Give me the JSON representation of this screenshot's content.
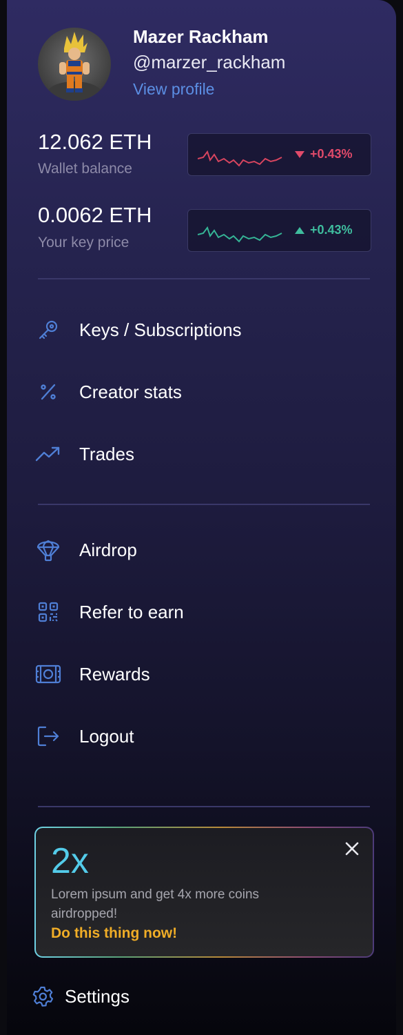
{
  "profile": {
    "name": "Mazer Rackham",
    "handle": "@marzer_rackham",
    "view_profile": "View profile"
  },
  "stats": [
    {
      "value": "12.062 ETH",
      "label": "Wallet balance",
      "change": "+0.43%",
      "trend": "down",
      "color": "#e04a6a"
    },
    {
      "value": "0.0062 ETH",
      "label": "Your key price",
      "change": "+0.43%",
      "trend": "up",
      "color": "#3fbd9e"
    }
  ],
  "menu": {
    "group1": [
      {
        "label": "Keys / Subscriptions",
        "icon": "key-icon"
      },
      {
        "label": "Creator stats",
        "icon": "percent-icon"
      },
      {
        "label": "Trades",
        "icon": "trending-up-icon"
      }
    ],
    "group2": [
      {
        "label": "Airdrop",
        "icon": "parachute-icon"
      },
      {
        "label": "Refer to earn",
        "icon": "qr-code-icon"
      },
      {
        "label": "Rewards",
        "icon": "ticket-icon"
      },
      {
        "label": "Logout",
        "icon": "logout-icon"
      }
    ]
  },
  "promo": {
    "multiplier": "2x",
    "text": "Lorem ipsum and get 4x more coins airdropped!",
    "cta": "Do this thing now!"
  },
  "settings": {
    "label": "Settings",
    "icon": "gear-icon"
  },
  "colors": {
    "accent_blue": "#5c8fe4",
    "positive": "#3fbd9e",
    "negative": "#e04a6a",
    "cta": "#f0ad27",
    "multiplier": "#53cbe9"
  }
}
